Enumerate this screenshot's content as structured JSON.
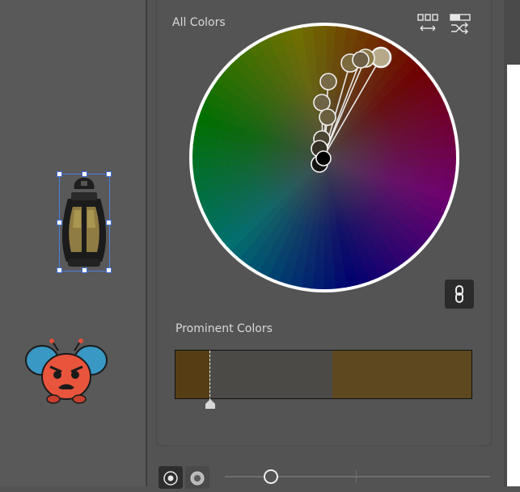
{
  "panel": {
    "all_colors_label": "All Colors",
    "prominent_colors_label": "Prominent Colors"
  },
  "toolbar_icons": [
    {
      "name": "colorize-by-range-icon"
    },
    {
      "name": "shuffle-colors-icon"
    }
  ],
  "link_toggle": {
    "icon": "link-icon",
    "state": "linked"
  },
  "prominent_colors": [
    {
      "color": "#563d14",
      "fraction": 0.115
    },
    {
      "color": "#4c4a46",
      "fraction": 0.416
    },
    {
      "color": "#5d4820",
      "fraction": 0.469
    }
  ],
  "prominent_marker_fraction": 0.115,
  "color_handles": [
    {
      "color": "#b5a98a",
      "base": true
    },
    {
      "color": "#7d6a3e"
    },
    {
      "color": "#8c7946"
    },
    {
      "color": "#6d6047"
    },
    {
      "color": "#786a46"
    },
    {
      "color": "#6e6347"
    },
    {
      "color": "#6a603f"
    },
    {
      "color": "#4b4534"
    },
    {
      "color": "#353026"
    },
    {
      "color": "#161412"
    },
    {
      "color": "#000000"
    }
  ],
  "display_modes": [
    {
      "name": "smooth-wheel-mode",
      "active": true
    },
    {
      "name": "segmented-wheel-mode",
      "active": false
    }
  ],
  "brightness_slider": {
    "value_fraction": 0.17
  }
}
